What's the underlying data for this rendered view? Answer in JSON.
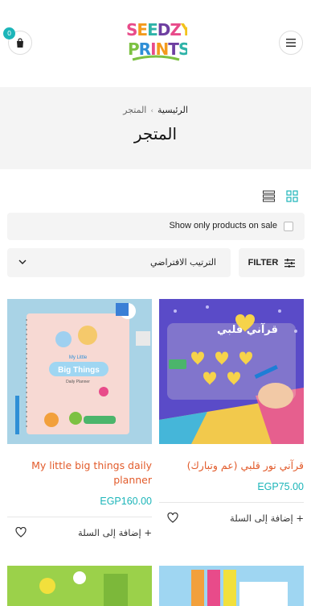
{
  "header": {
    "cart_count": "0",
    "logo_line1": "SEEDZY",
    "logo_line2": "PRINTS"
  },
  "breadcrumb": {
    "home": "الرئيسية",
    "separator": "›",
    "current": "المتجر"
  },
  "page_title": "المتجر",
  "filters": {
    "sale_label": "Show only products on sale",
    "sort_value": "الترتيب الافتراضي",
    "filter_label": "FILTER"
  },
  "products": [
    {
      "title": "(قرآني نور قلبي (عم وتبارك",
      "price": "EGP75.00",
      "add_label": "+ إضافة إلى السلة",
      "image_text": "قرآني قلبي"
    },
    {
      "title": "My little big things daily planner",
      "price": "EGP160.00",
      "add_label": "+ إضافة إلى السلة",
      "image_text_1": "My Little",
      "image_text_2": "Big Things",
      "image_text_3": "Daily Planner"
    }
  ],
  "colors": {
    "accent": "#1cb5b9",
    "title": "#e25b2b",
    "panel": "#f4f4f4"
  }
}
